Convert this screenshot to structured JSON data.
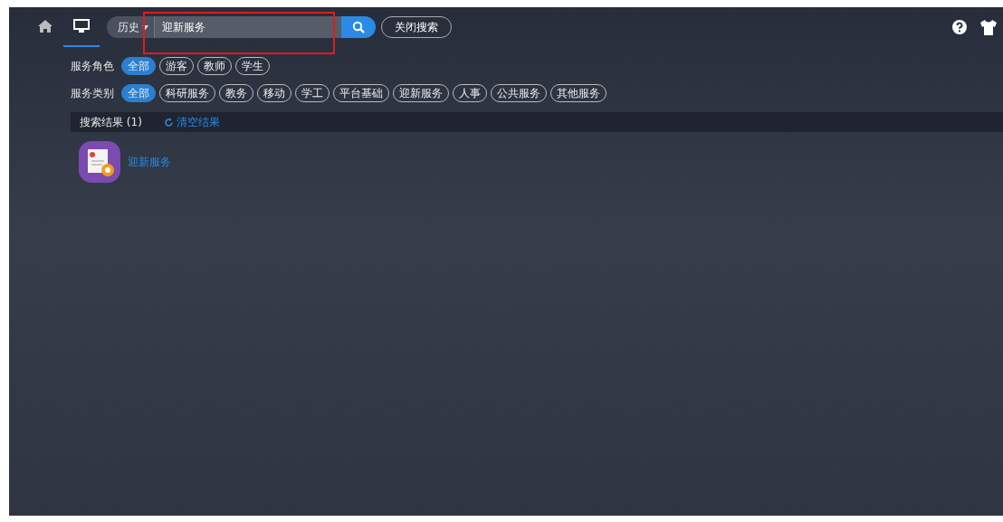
{
  "nav": [
    {
      "kind": "home",
      "selected": false
    },
    {
      "kind": "desktop",
      "selected": true
    }
  ],
  "search": {
    "history_label": "历史",
    "value": "迎新服务",
    "close_label": "关闭搜索"
  },
  "filters": [
    {
      "label": "服务角色",
      "chips": [
        {
          "label": "全部",
          "selected": true
        },
        {
          "label": "游客",
          "selected": false
        },
        {
          "label": "教师",
          "selected": false
        },
        {
          "label": "学生",
          "selected": false
        }
      ]
    },
    {
      "label": "服务类别",
      "chips": [
        {
          "label": "全部",
          "selected": true
        },
        {
          "label": "科研服务",
          "selected": false
        },
        {
          "label": "教务",
          "selected": false
        },
        {
          "label": "移动",
          "selected": false
        },
        {
          "label": "学工",
          "selected": false
        },
        {
          "label": "平台基础",
          "selected": false
        },
        {
          "label": "迎新服务",
          "selected": false
        },
        {
          "label": "人事",
          "selected": false
        },
        {
          "label": "公共服务",
          "selected": false
        },
        {
          "label": "其他服务",
          "selected": false
        }
      ]
    }
  ],
  "results": {
    "title": "搜索结果 (1)",
    "clear_label": "清空结果"
  },
  "items": [
    {
      "name": "迎新服务"
    }
  ]
}
